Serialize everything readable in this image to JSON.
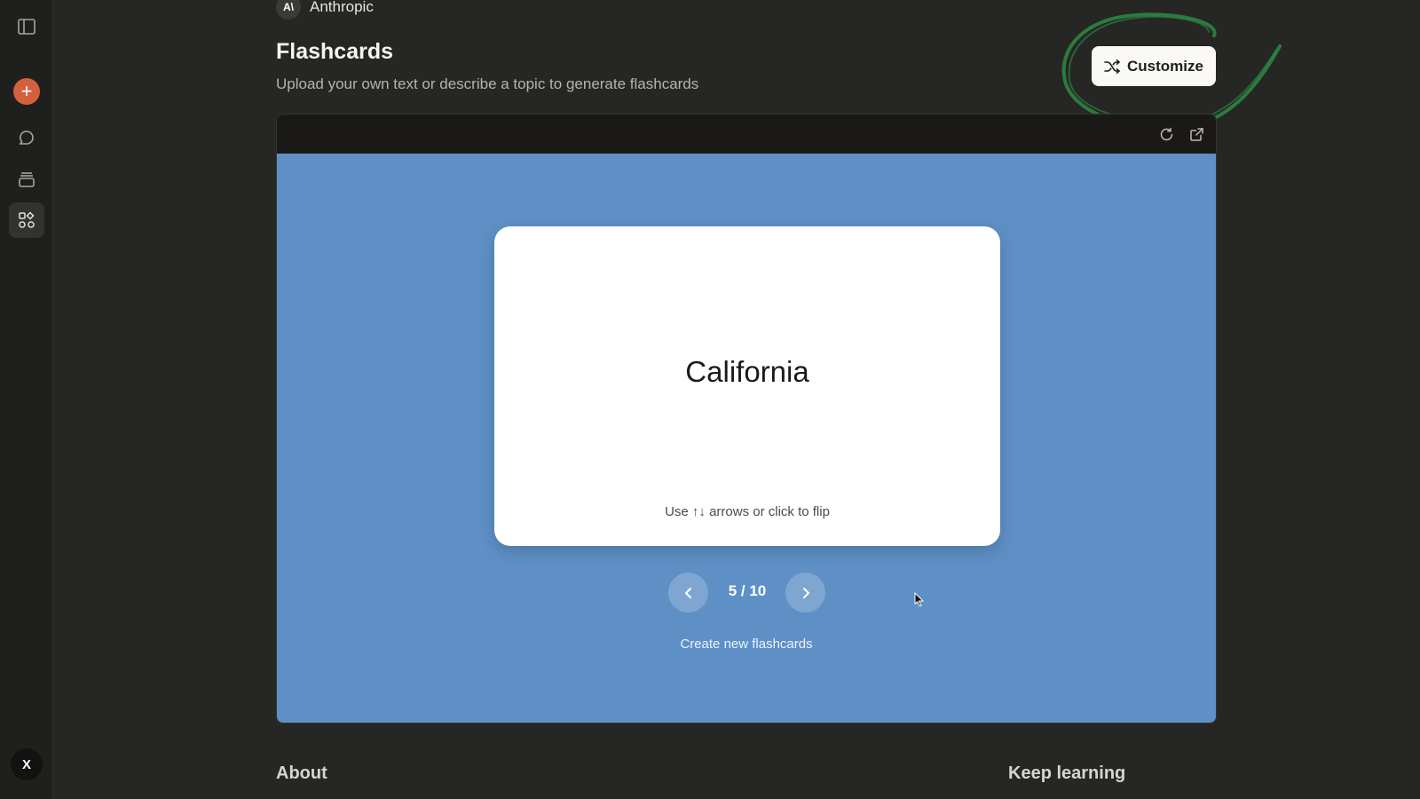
{
  "sidebar": {
    "icons": [
      "sidebar-toggle-icon",
      "plus-icon",
      "chat-bubble-icon",
      "projects-icon",
      "artifacts-icon"
    ],
    "avatar_initial": "X"
  },
  "org": {
    "logo_text": "A\\",
    "name": "Anthropic"
  },
  "header": {
    "title": "Flashcards",
    "subtitle": "Upload your own text or describe a topic to generate flashcards",
    "customize_label": "Customize"
  },
  "annotation_color": "#2e8b43",
  "artifact": {
    "background": "#5e90c6",
    "toolbar_icons": [
      "refresh-icon",
      "open-external-icon"
    ],
    "card": {
      "term": "California",
      "hint": "Use ↑↓ arrows or click to flip"
    },
    "pager": {
      "counter": "5 / 10"
    },
    "create_label": "Create new flashcards"
  },
  "footer": {
    "about": "About",
    "keep_learning": "Keep learning"
  }
}
